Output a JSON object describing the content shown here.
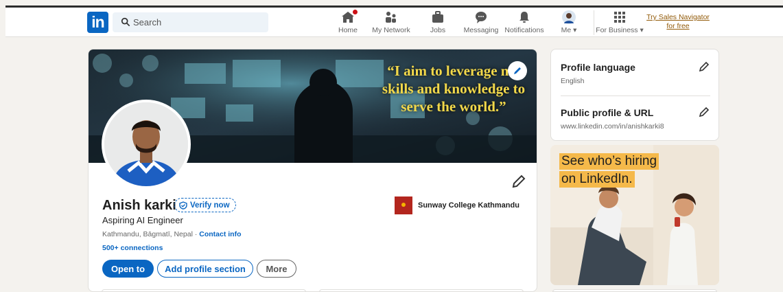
{
  "nav": {
    "logo_text": "in",
    "search_placeholder": "Search",
    "items": [
      {
        "label": "Home"
      },
      {
        "label": "My Network"
      },
      {
        "label": "Jobs"
      },
      {
        "label": "Messaging"
      },
      {
        "label": "Notifications"
      },
      {
        "label": "Me"
      },
      {
        "label": "For Business"
      }
    ],
    "sales_line1": "Try Sales Navigator",
    "sales_line2": "for free"
  },
  "profile": {
    "banner_quote": "“I aim to leverage my skills and knowledge to serve the world.”",
    "name": "Anish karki",
    "verify_label": "Verify now",
    "headline": "Aspiring AI Engineer",
    "location": "Kathmandu, Bāgmatī, Nepal",
    "location_separator": " · ",
    "contact_label": "Contact info",
    "connections": "500+ connections",
    "education": "Sunway College Kathmandu",
    "buttons": {
      "open_to": "Open to",
      "add_section": "Add profile section",
      "more": "More"
    }
  },
  "sidebar": {
    "language_title": "Profile language",
    "language_value": "English",
    "url_title": "Public profile & URL",
    "url_value": "www.linkedin.com/in/anishkarki8"
  },
  "ad": {
    "line1": "See who’s hiring",
    "line2": "on LinkedIn."
  },
  "colors": {
    "brand": "#0a66c2",
    "background": "#f4f2ee",
    "notification_badge": "#cc1016",
    "banner_text": "#f2d84a",
    "ad_highlight": "#f5b94a"
  }
}
